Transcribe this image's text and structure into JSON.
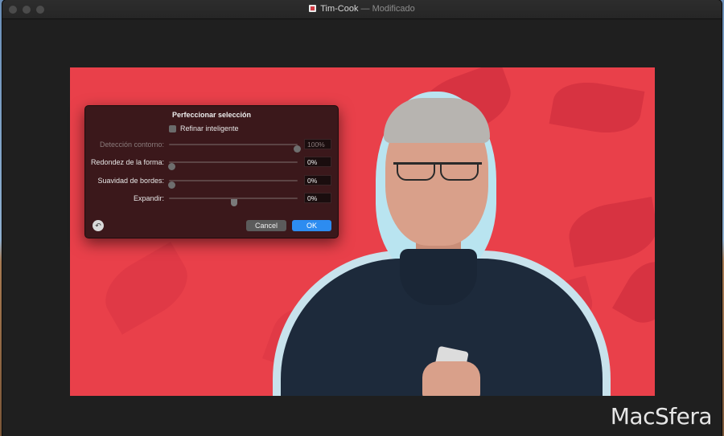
{
  "window": {
    "title": "Tim-Cook",
    "title_separator": " — ",
    "title_status": "Modificado"
  },
  "dialog": {
    "title": "Perfeccionar selección",
    "smart_refine_label": "Refinar inteligente",
    "smart_refine_checked": false,
    "sliders": [
      {
        "label": "Detección contorno:",
        "value": "100%",
        "level": 1.0,
        "enabled": false
      },
      {
        "label": "Redondez de la forma:",
        "value": "0%",
        "level": 0.0,
        "enabled": true
      },
      {
        "label": "Suavidad de bordes:",
        "value": "0%",
        "level": 0.0,
        "enabled": true
      },
      {
        "label": "Expandir:",
        "value": "0%",
        "level": 0.5,
        "enabled": true
      }
    ],
    "reset_icon": "undo-arrow-icon",
    "cancel_label": "Cancel",
    "ok_label": "OK"
  },
  "watermark": "MacSfera",
  "colors": {
    "accent": "#2d8cf0",
    "background_red": "#e9404a",
    "dialog_bg": "#2d1618"
  }
}
